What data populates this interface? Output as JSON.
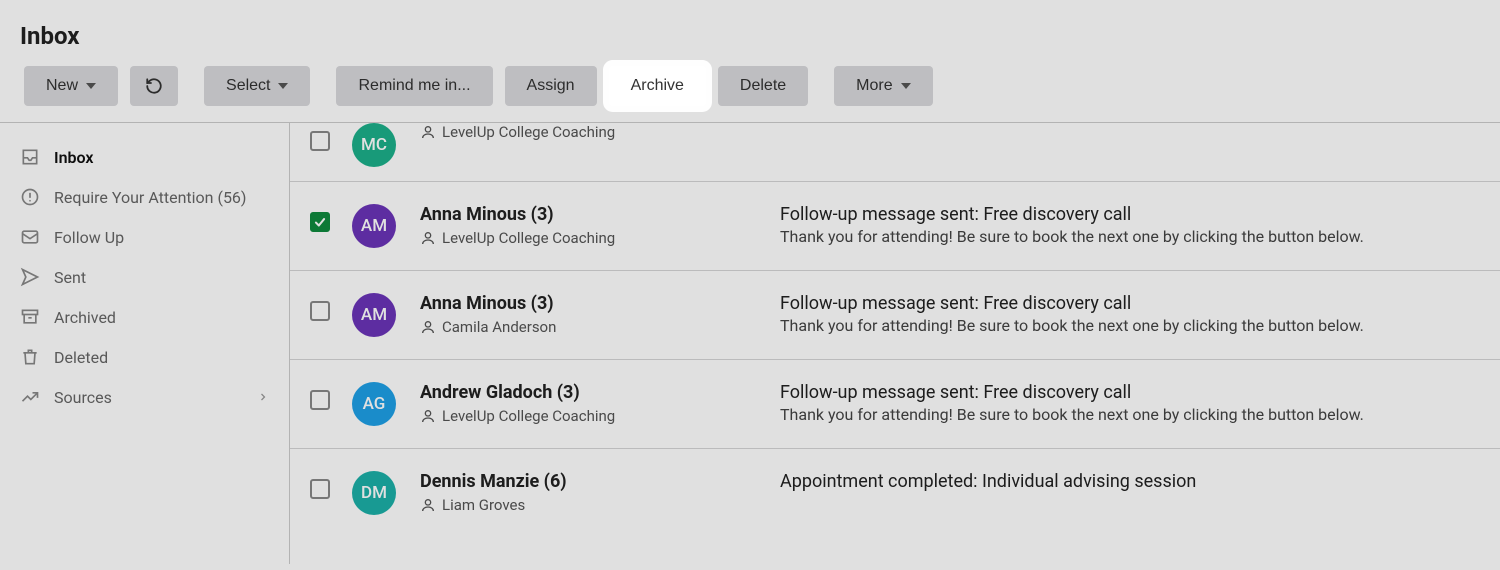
{
  "header": {
    "title": "Inbox"
  },
  "toolbar": {
    "new_label": "New",
    "select_label": "Select",
    "remind_label": "Remind me in...",
    "assign_label": "Assign",
    "archive_label": "Archive",
    "delete_label": "Delete",
    "more_label": "More"
  },
  "sidebar": {
    "items": [
      {
        "label": "Inbox"
      },
      {
        "label": "Require Your Attention (56)"
      },
      {
        "label": "Follow Up"
      },
      {
        "label": "Sent"
      },
      {
        "label": "Archived"
      },
      {
        "label": "Deleted"
      },
      {
        "label": "Sources"
      }
    ]
  },
  "messages": [
    {
      "initials": "MC",
      "avatar_color": "#1cb08a",
      "checked": false,
      "name": "",
      "org": "LevelUp College Coaching",
      "subject": "",
      "preview": ""
    },
    {
      "initials": "AM",
      "avatar_color": "#6a34b8",
      "checked": true,
      "name": "Anna Minous (3)",
      "org": "LevelUp College Coaching",
      "subject": "Follow-up message sent: Free discovery call",
      "preview": "Thank you for attending! Be sure to book the next one by clicking the button below."
    },
    {
      "initials": "AM",
      "avatar_color": "#6a34b8",
      "checked": false,
      "name": "Anna Minous (3)",
      "org": "Camila Anderson",
      "subject": "Follow-up message sent: Free discovery call",
      "preview": "Thank you for attending! Be sure to book the next one by clicking the button below."
    },
    {
      "initials": "AG",
      "avatar_color": "#1ea0e6",
      "checked": false,
      "name": "Andrew Gladoch (3)",
      "org": "LevelUp College Coaching",
      "subject": "Follow-up message sent: Free discovery call",
      "preview": "Thank you for attending! Be sure to book the next one by clicking the button below."
    },
    {
      "initials": "DM",
      "avatar_color": "#1cb0a8",
      "checked": false,
      "name": "Dennis Manzie (6)",
      "org": "Liam Groves",
      "subject": "Appointment completed: Individual advising session",
      "preview": ""
    }
  ]
}
